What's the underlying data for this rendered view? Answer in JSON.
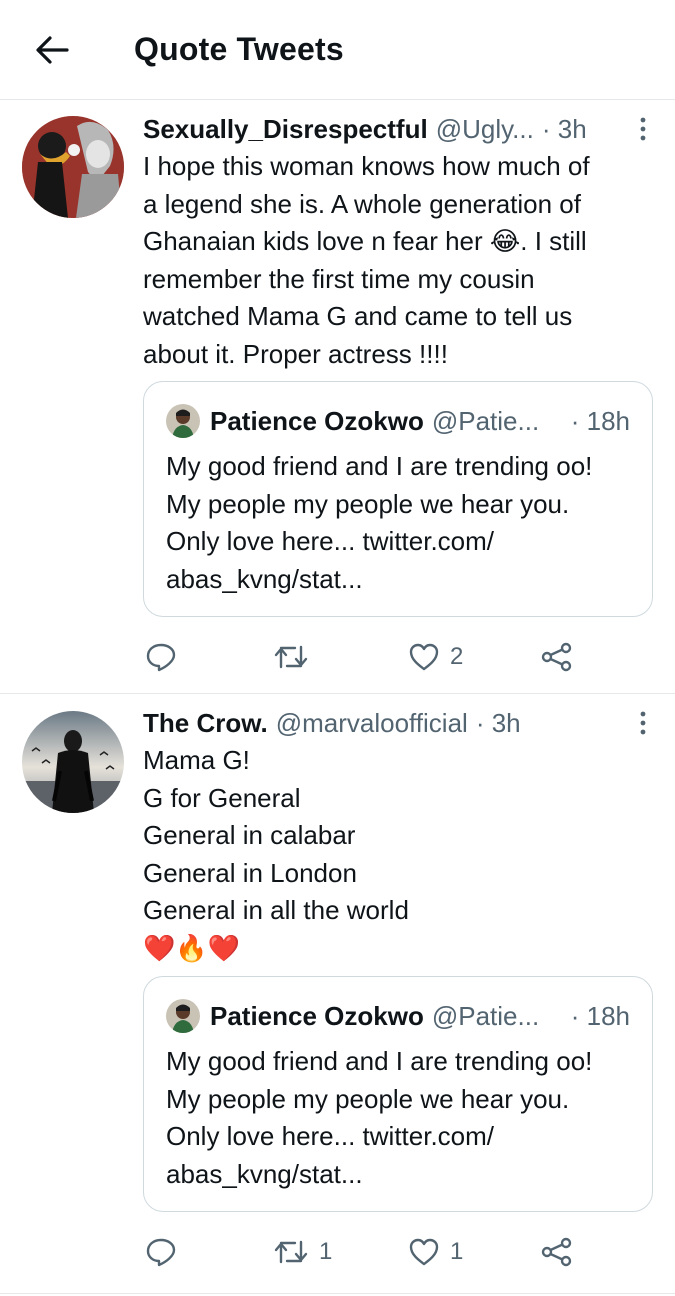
{
  "header": {
    "title": "Quote Tweets",
    "back_icon": "arrow-left-icon"
  },
  "tweets": [
    {
      "author_name": "Sexually_Disrespectful",
      "handle": "@Ugly...",
      "time": "· 3h",
      "lines": [
        "I hope this woman knows how much of",
        "a legend she is. A whole generation of",
        "Ghanaian kids love n fear her 😂. I still",
        "remember the first time my cousin",
        "watched Mama G and came to tell us",
        "about it. Proper actress !!!!"
      ],
      "quote": {
        "author_name": "Patience Ozokwo",
        "handle": "@Patie...",
        "time": "· 18h",
        "lines": [
          "My good friend and I are trending oo!",
          "My people my people we hear you.",
          "Only love here... twitter.com/",
          "abas_kvng/stat..."
        ]
      },
      "actions": {
        "reply": "",
        "retweet": "",
        "like": "2"
      }
    },
    {
      "author_name": "The Crow.",
      "handle": "@marvaloofficial",
      "time": "· 3h",
      "lines": [
        "Mama G!",
        "G for General",
        "General in calabar",
        "General in London",
        "General in all the world",
        "❤️🔥❤️"
      ],
      "quote": {
        "author_name": "Patience Ozokwo",
        "handle": "@Patie...",
        "time": "· 18h",
        "lines": [
          "My good friend and I are trending oo!",
          "My people my people we hear you.",
          "Only love here... twitter.com/",
          "abas_kvng/stat..."
        ]
      },
      "actions": {
        "reply": "",
        "retweet": "1",
        "like": "1"
      }
    }
  ],
  "colors": {
    "text": "#0f1419",
    "secondary": "#536471",
    "border": "#cfd9de",
    "divider": "#e6e9ec"
  }
}
